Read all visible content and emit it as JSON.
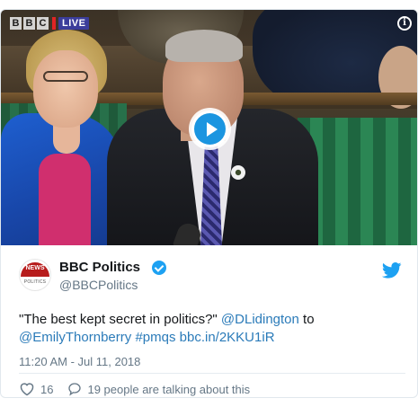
{
  "video": {
    "channel_logo": "BBC",
    "channel_letters": [
      "B",
      "B",
      "C"
    ],
    "live_label": "LIVE",
    "info_icon": "info-icon",
    "play_icon": "play-icon"
  },
  "author": {
    "display_name": "BBC Politics",
    "handle": "@BBCPolitics",
    "avatar_news": "NEWS",
    "avatar_sub": "POLITICS",
    "verified_icon": "verified-badge-icon"
  },
  "tweet": {
    "text_start": "\"The best kept secret in politics?\" ",
    "mention_1": "@DLidington",
    "text_mid": " to ",
    "mention_2": "@EmilyThornberry",
    "hashtag": "#pmqs",
    "link": "bbc.in/2KKU1iR",
    "timestamp": "11:20 AM - Jul 11, 2018"
  },
  "actions": {
    "like_count": "16",
    "conversation_text": "19 people are talking about this"
  },
  "colors": {
    "link": "#2b7bb9",
    "twitter_blue": "#1da1f2",
    "play_blue": "#1b95e0",
    "muted": "#657786"
  }
}
